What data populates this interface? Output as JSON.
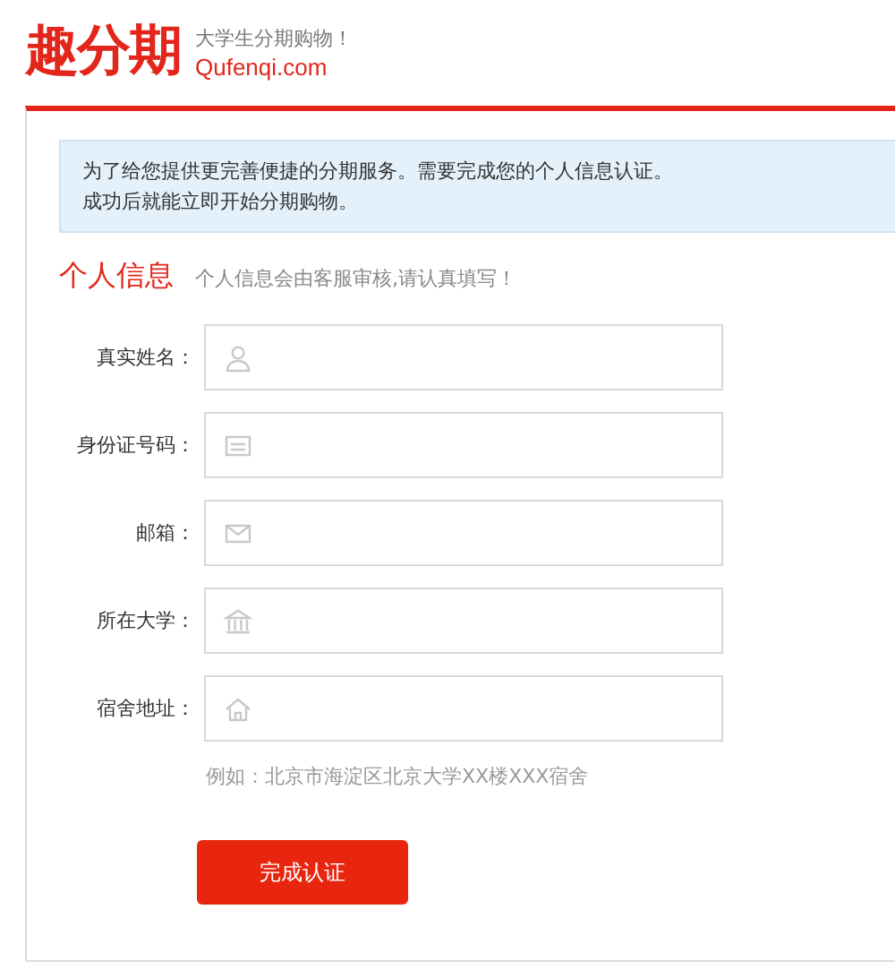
{
  "header": {
    "logo": "趣分期",
    "tagline": "大学生分期购物！",
    "domain": "Qufenqi.com"
  },
  "notice": [
    "为了给您提供更完善便捷的分期服务。需要完成您的个人信息认证。",
    "成功后就能立即开始分期购物。"
  ],
  "section": {
    "title": "个人信息",
    "subtitle": "个人信息会由客服审核,请认真填写！"
  },
  "fields": [
    {
      "label": "真实姓名：",
      "kind": "person"
    },
    {
      "label": "身份证号码：",
      "kind": "card"
    },
    {
      "label": "邮箱：",
      "kind": "mail"
    },
    {
      "label": "所在大学：",
      "kind": "school"
    },
    {
      "label": "宿舍地址：",
      "kind": "home"
    }
  ],
  "hint": "例如：北京市海淀区北京大学XX楼XXX宿舍",
  "submit": "完成认证"
}
